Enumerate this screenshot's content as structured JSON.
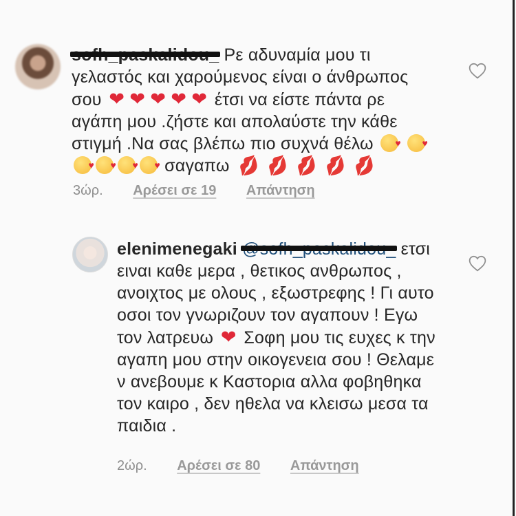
{
  "comments": [
    {
      "username": "sofh_paskalidou_",
      "text_line1": "Ρε αδυναμία μου τι γελαστός και χαρούμενος είναι ο άνθρωπος σου",
      "text_line2": "έτσι να είστε πάντα ρε αγάπη μου .ζήστε  και απολαύστε την κάθε στιγμή .Να σας βλέπω πιο συχνά θέλω",
      "text_line3": "σαγαπω",
      "time": "3ώρ.",
      "likes": "Αρέσει σε 19",
      "reply": "Απάντηση"
    },
    {
      "username": "elenimenegaki",
      "mention": "@sofh_paskalidou_",
      "text_line1": "ετσι ειναι καθε μερα , θετικος ανθρωπος , ανοιχτος με ολους , εξωστρεφης ! Γι αυτο οσοι τον γνωριζουν τον αγαπουν ! Εγω τον λατρευω",
      "text_line2": "Σοφη μου τις ευχες κ την αγαπη μου στην οικογενεια σου ! Θελαμε ν ανεβουμε κ Καστορια αλλα φοβηθηκα τον καιρο , δεν ηθελα να κλεισω μεσα τα παιδια .",
      "time": "2ώρ.",
      "likes": "Αρέσει σε 80",
      "reply": "Απάντηση"
    }
  ],
  "icons": {
    "like": "heart-outline-icon",
    "heart_emoji": "red-heart",
    "kiss_face": "face-blowing-kiss",
    "lips": "kiss-mark"
  },
  "colors": {
    "background": "#fafafa",
    "text": "#262626",
    "meta": "#8e8e8e",
    "heart": "#e02838"
  }
}
